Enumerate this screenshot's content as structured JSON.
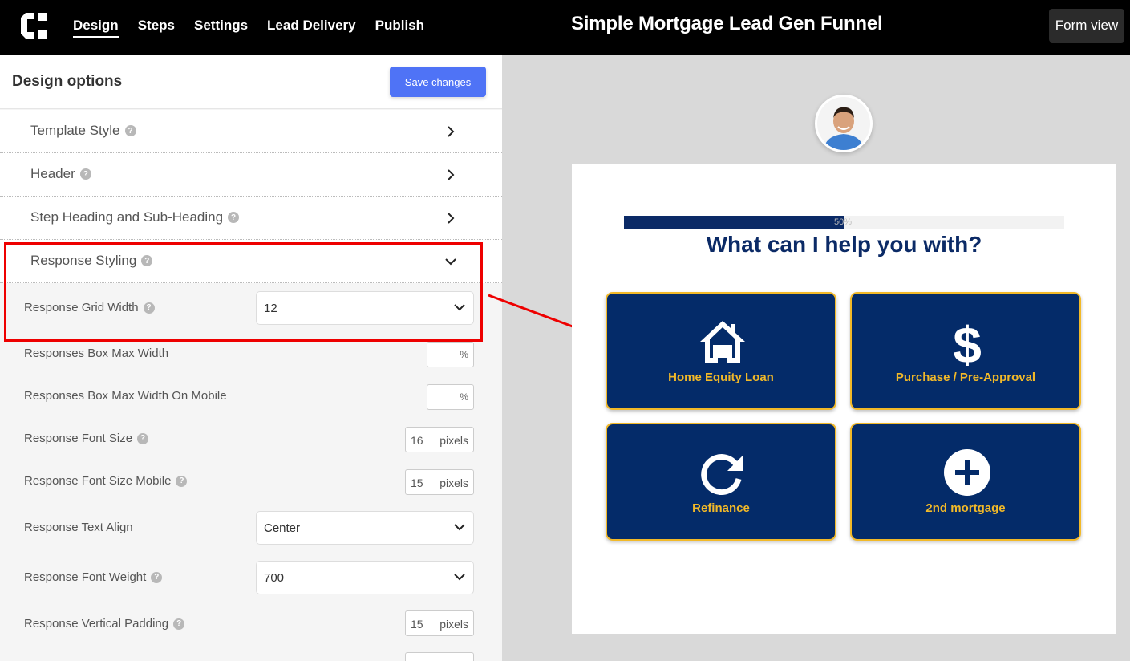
{
  "nav": {
    "items": [
      "Design",
      "Steps",
      "Settings",
      "Lead Delivery",
      "Publish"
    ],
    "active": "Design"
  },
  "app_title": "Simple Mortgage Lead Gen Funnel",
  "form_view": "Form view",
  "panel": {
    "title": "Design options",
    "save": "Save changes"
  },
  "accordion": [
    {
      "label": "Template Style"
    },
    {
      "label": "Header"
    },
    {
      "label": "Step Heading and Sub-Heading"
    },
    {
      "label": "Response Styling"
    }
  ],
  "settings": {
    "grid_width": {
      "label": "Response Grid Width",
      "value": "12"
    },
    "box_max_width": {
      "label": "Responses Box Max Width",
      "unit": "%"
    },
    "box_max_width_mobile": {
      "label": "Responses Box Max Width On Mobile",
      "unit": "%"
    },
    "font_size": {
      "label": "Response Font Size",
      "value": "16",
      "unit": "pixels"
    },
    "font_size_mobile": {
      "label": "Response Font Size Mobile",
      "value": "15",
      "unit": "pixels"
    },
    "text_align": {
      "label": "Response Text Align",
      "value": "Center"
    },
    "font_weight": {
      "label": "Response Font Weight",
      "value": "700"
    },
    "vertical_padding": {
      "label": "Response Vertical Padding",
      "value": "15",
      "unit": "pixels"
    }
  },
  "preview": {
    "progress_percent": 50,
    "progress_text": "50%",
    "question": "What can I help you with?",
    "responses": [
      {
        "label": "Home Equity Loan",
        "icon": "house-icon"
      },
      {
        "label": "Purchase / Pre-Approval",
        "icon": "dollar-icon"
      },
      {
        "label": "Refinance",
        "icon": "refresh-icon"
      },
      {
        "label": "2nd mortgage",
        "icon": "plus-circle-icon"
      }
    ]
  },
  "colors": {
    "accent": "#4f73f6",
    "navy": "#042b69",
    "gold": "#f2b928",
    "highlight": "#ee0000"
  }
}
